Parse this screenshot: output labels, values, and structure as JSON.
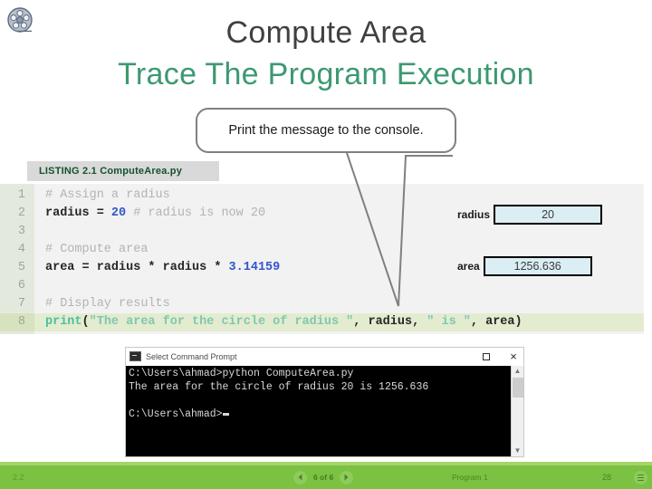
{
  "slide": {
    "title": "Compute Area",
    "subtitle": "Trace The Program Execution",
    "reel_icon": "film-reel-icon"
  },
  "callout": {
    "text": "Print the message to the console."
  },
  "listing": {
    "label": "LISTING 2.1 ComputeArea.py"
  },
  "code": {
    "lines": [
      {
        "number": "1",
        "highlight": false,
        "tokens": [
          {
            "t": "# Assign a radius",
            "c": "tok-comment"
          }
        ]
      },
      {
        "number": "2",
        "highlight": false,
        "tokens": [
          {
            "t": "radius = ",
            "c": "tok-plain"
          },
          {
            "t": "20",
            "c": "tok-num"
          },
          {
            "t": " # radius is now 20",
            "c": "tok-comment"
          }
        ]
      },
      {
        "number": "3",
        "highlight": false,
        "tokens": [
          {
            "t": "",
            "c": "tok-plain"
          }
        ]
      },
      {
        "number": "4",
        "highlight": false,
        "tokens": [
          {
            "t": "# Compute area",
            "c": "tok-comment"
          }
        ]
      },
      {
        "number": "5",
        "highlight": false,
        "tokens": [
          {
            "t": "area = radius * radius * ",
            "c": "tok-plain"
          },
          {
            "t": "3.14159",
            "c": "tok-num"
          }
        ]
      },
      {
        "number": "6",
        "highlight": false,
        "tokens": [
          {
            "t": "",
            "c": "tok-plain"
          }
        ]
      },
      {
        "number": "7",
        "highlight": false,
        "tokens": [
          {
            "t": "# Display results",
            "c": "tok-comment"
          }
        ]
      },
      {
        "number": "8",
        "highlight": true,
        "tokens": [
          {
            "t": "print",
            "c": "tok-fn"
          },
          {
            "t": "(",
            "c": "tok-plain"
          },
          {
            "t": "\"The area for the circle of radius \"",
            "c": "tok-str"
          },
          {
            "t": ", radius, ",
            "c": "tok-plain"
          },
          {
            "t": "\" is \"",
            "c": "tok-str"
          },
          {
            "t": ", area)",
            "c": "tok-plain"
          }
        ]
      }
    ]
  },
  "variables": [
    {
      "label": "radius",
      "value": "20"
    },
    {
      "label": "area",
      "value": "1256.636"
    }
  ],
  "console": {
    "title": "Select Command Prompt",
    "maximize_label": "□",
    "close_label": "×",
    "lines": [
      "C:\\Users\\ahmad>python ComputeArea.py",
      "The area for the circle of radius 20 is 1256.636",
      "",
      "C:\\Users\\ahmad>"
    ]
  },
  "footer": {
    "section": "2.2",
    "pages": "6 of 6",
    "center_label": "Program 1",
    "page_number": "28",
    "prev_icon": "chevron-left-icon",
    "next_icon": "chevron-right-icon",
    "menu_icon": "hamburger-menu-icon"
  },
  "colors": {
    "accent_green": "#3d9970",
    "footer_green": "#7bc142",
    "title_gray": "#404040",
    "varbox_fill": "#daeef3",
    "code_bg": "#f2f2f2",
    "highlight_row": "#e3eccf"
  }
}
